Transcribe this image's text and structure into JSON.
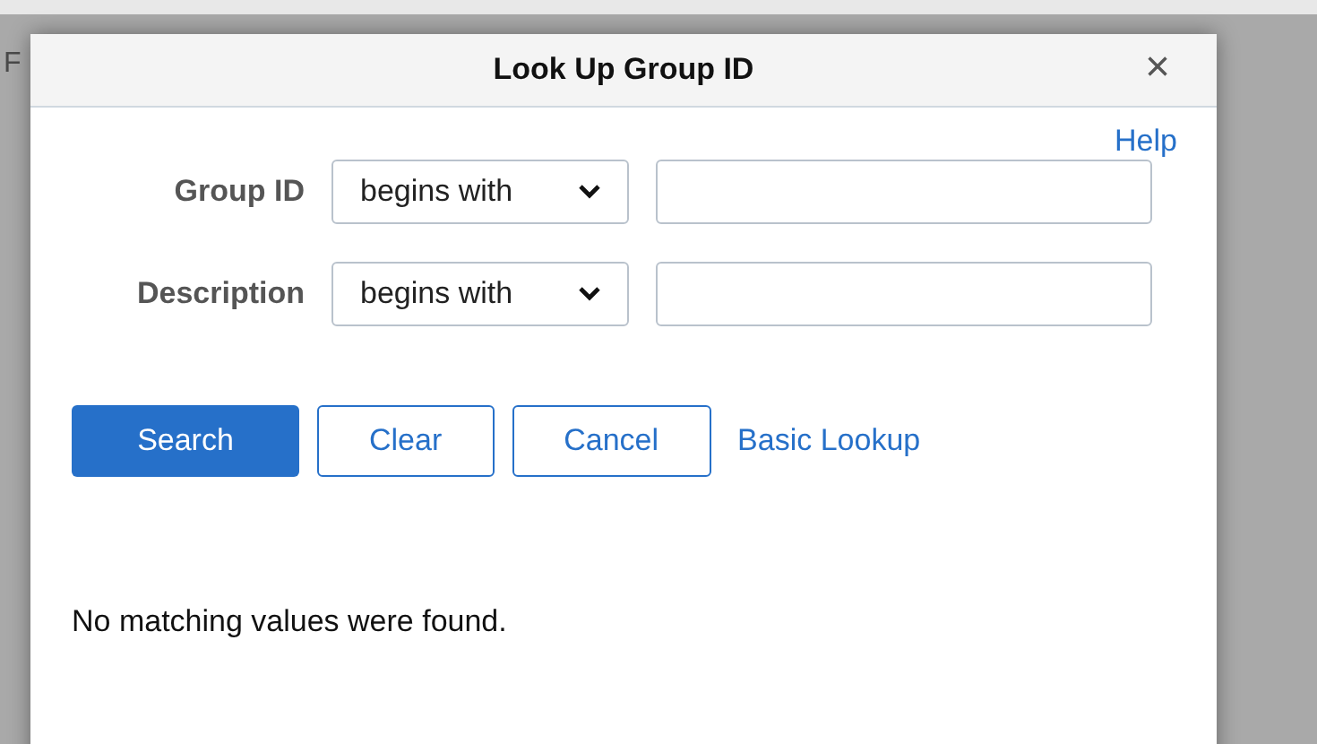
{
  "background": {
    "text": "F"
  },
  "dialog": {
    "title": "Look Up Group ID",
    "close": "×",
    "help": "Help",
    "fields": [
      {
        "label": "Group ID",
        "operator": "begins with"
      },
      {
        "label": "Description",
        "operator": "begins with"
      }
    ],
    "buttons": [
      {
        "label": "Search",
        "kind": "primary"
      },
      {
        "label": "Clear",
        "kind": "secondary"
      },
      {
        "label": "Cancel",
        "kind": "secondary"
      },
      {
        "label": "Basic Lookup",
        "kind": "link"
      }
    ],
    "message": "No matching values were found."
  }
}
